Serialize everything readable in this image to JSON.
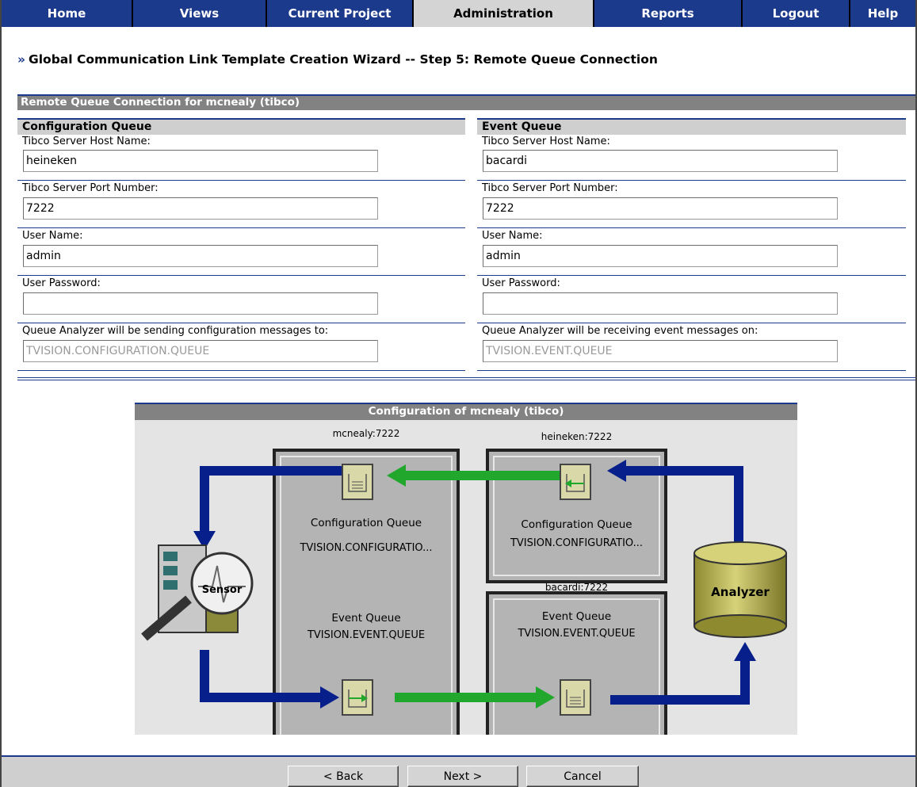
{
  "nav": {
    "tabs": [
      {
        "label": "Home",
        "active": false
      },
      {
        "label": "Views",
        "active": false
      },
      {
        "label": "Current Project",
        "active": false
      },
      {
        "label": "Administration",
        "active": true
      },
      {
        "label": "Reports",
        "active": false
      },
      {
        "label": "Logout",
        "active": false
      },
      {
        "label": "Help",
        "active": false
      }
    ]
  },
  "page": {
    "chevron": "»",
    "title": "Global Communication Link Template Creation Wizard -- Step 5: Remote Queue Connection"
  },
  "section": {
    "title": "Remote Queue Connection for mcnealy (tibco)"
  },
  "config_queue": {
    "header": "Configuration Queue",
    "host_label": "Tibco Server Host Name:",
    "host_value": "heineken",
    "port_label": "Tibco Server Port Number:",
    "port_value": "7222",
    "user_label": "User Name:",
    "user_value": "admin",
    "password_label": "User Password:",
    "password_value": "",
    "queue_label": "Queue Analyzer will be sending configuration messages to:",
    "queue_value": "TVISION.CONFIGURATION.QUEUE"
  },
  "event_queue": {
    "header": "Event Queue",
    "host_label": "Tibco Server Host Name:",
    "host_value": "bacardi",
    "port_label": "Tibco Server Port Number:",
    "port_value": "7222",
    "user_label": "User Name:",
    "user_value": "admin",
    "password_label": "User Password:",
    "password_value": "",
    "queue_label": "Queue Analyzer will be receiving event messages on:",
    "queue_value": "TVISION.EVENT.QUEUE"
  },
  "diagram": {
    "title": "Configuration of mcnealy (tibco)",
    "left_server_label": "mcnealy:7222",
    "left_config_queue_label": "Configuration Queue",
    "left_config_queue_name": "TVISION.CONFIGURATIO...",
    "left_event_queue_label": "Event Queue",
    "left_event_queue_name": "TVISION.EVENT.QUEUE",
    "right_top_server_label": "heineken:7222",
    "right_config_queue_label": "Configuration Queue",
    "right_config_queue_name": "TVISION.CONFIGURATIO...",
    "right_bottom_server_label": "bacardi:7222",
    "right_event_queue_label": "Event Queue",
    "right_event_queue_name": "TVISION.EVENT.QUEUE",
    "sensor_label": "Sensor",
    "analyzer_label": "Analyzer"
  },
  "footer": {
    "back_label": "< Back",
    "next_label": "Next >",
    "cancel_label": "Cancel"
  },
  "colors": {
    "nav_blue": "#1c3a8c",
    "header_gray": "#828282",
    "flow_blue": "#061f8a",
    "flow_green": "#21a82c",
    "queue_icon": "#d8d8a8",
    "analyzer": "#b8b45a"
  }
}
